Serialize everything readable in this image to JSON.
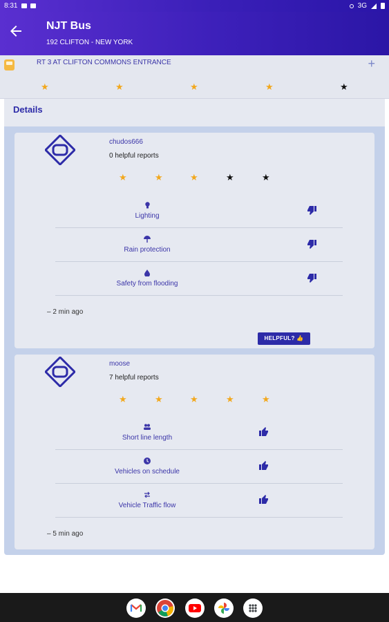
{
  "status_bar": {
    "time": "8:31",
    "network": "3G"
  },
  "app_bar": {
    "title": "NJT Bus",
    "subtitle": "192 CLIFTON - NEW YORK"
  },
  "stop": {
    "name": "RT 3 AT CLIFTON COMMONS ENTRANCE",
    "rating": 4,
    "max_rating": 5,
    "add_icon": "plus-icon"
  },
  "details": {
    "label": "Details",
    "reports": [
      {
        "user": "chudos666",
        "helpful_reports": "0 helpful reports",
        "rating": 3,
        "features": [
          {
            "icon": "lightbulb-icon",
            "label": "Lighting",
            "vote": "thumbs-down"
          },
          {
            "icon": "umbrella-icon",
            "label": "Rain protection",
            "vote": "thumbs-down"
          },
          {
            "icon": "water-drop-icon",
            "label": "Safety from flooding",
            "vote": "thumbs-down"
          }
        ],
        "time_ago": "– 2 min ago",
        "helpful_button": "HELPFUL?"
      },
      {
        "user": "moose",
        "helpful_reports": "7 helpful reports",
        "rating": 5,
        "features": [
          {
            "icon": "people-icon",
            "label": "Short line length",
            "vote": "thumbs-up"
          },
          {
            "icon": "clock-icon",
            "label": "Vehicles on schedule",
            "vote": "thumbs-up"
          },
          {
            "icon": "swap-arrows-icon",
            "label": "Vehicle Traffic flow",
            "vote": "thumbs-up"
          }
        ],
        "time_ago": "– 5 min ago"
      }
    ]
  },
  "dock": [
    "gmail-icon",
    "chrome-icon",
    "youtube-icon",
    "photos-icon",
    "app-drawer-icon"
  ],
  "colors": {
    "brand": "#3d20ba",
    "accent_star": "#f2a81d",
    "link": "#3b35a8"
  }
}
